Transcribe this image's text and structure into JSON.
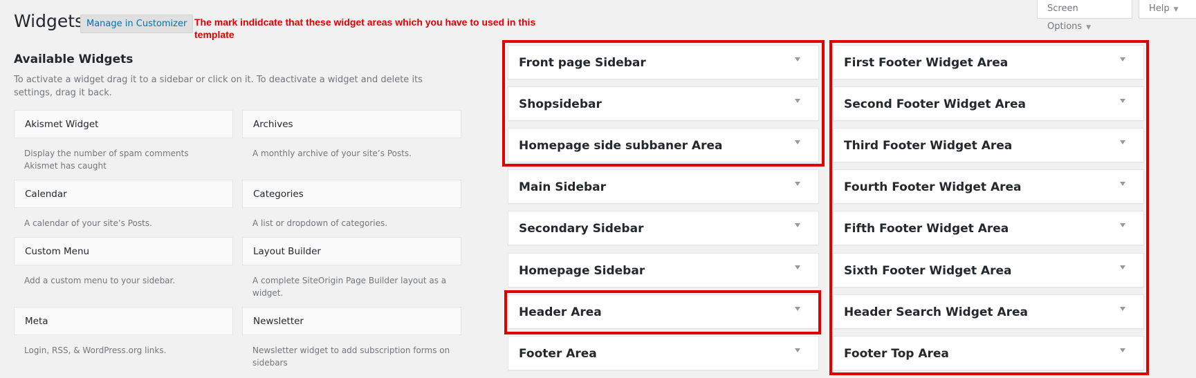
{
  "header": {
    "title": "Widgets",
    "customizer_label": "Manage in Customizer",
    "annotation": "The mark indidcate that these widget areas which you have to used in this template",
    "screen_options_label": "Screen Options",
    "help_label": "Help"
  },
  "available": {
    "title": "Available Widgets",
    "description": "To activate a widget drag it to a sidebar or click on it. To deactivate a widget and delete its settings, drag it back.",
    "widgets": [
      {
        "name": "Akismet Widget",
        "desc": "Display the number of spam comments Akismet has caught"
      },
      {
        "name": "Archives",
        "desc": "A monthly archive of your site’s Posts."
      },
      {
        "name": "Calendar",
        "desc": "A calendar of your site’s Posts."
      },
      {
        "name": "Categories",
        "desc": "A list or dropdown of categories."
      },
      {
        "name": "Custom Menu",
        "desc": "Add a custom menu to your sidebar."
      },
      {
        "name": "Layout Builder",
        "desc": "A complete SiteOrigin Page Builder layout as a widget."
      },
      {
        "name": "Meta",
        "desc": "Login, RSS, & WordPress.org links."
      },
      {
        "name": "Newsletter",
        "desc": "Newsletter widget to add subscription forms on sidebars"
      }
    ]
  },
  "sidebars_left": [
    "Front page Sidebar",
    "Shopsidebar",
    "Homepage side subbaner Area",
    "Main Sidebar",
    "Secondary Sidebar",
    "Homepage Sidebar",
    "Header Area",
    "Footer Area"
  ],
  "sidebars_right": [
    "First Footer Widget Area",
    "Second Footer Widget Area",
    "Third Footer Widget Area",
    "Fourth Footer Widget Area",
    "Fifth Footer Widget Area",
    "Sixth Footer Widget Area",
    "Header Search Widget Area",
    "Footer Top Area"
  ],
  "colors": {
    "highlight": "#e00000",
    "link": "#0073aa",
    "background": "#f1f1f1"
  },
  "icons": {
    "caret": "caret-down-icon"
  }
}
